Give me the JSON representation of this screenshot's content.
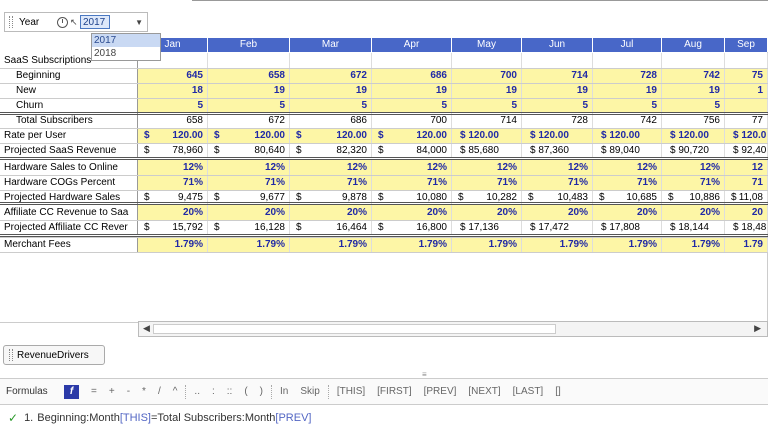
{
  "selector": {
    "label": "Year",
    "value": "2017",
    "options": [
      "2017",
      "2018"
    ]
  },
  "months": [
    "Jan",
    "Feb",
    "Mar",
    "Apr",
    "May",
    "Jun",
    "Jul",
    "Aug",
    "Sep"
  ],
  "rows": [
    {
      "label": "SaaS Subscriptions",
      "cells": [
        "",
        "",
        "",
        "",
        "",
        "",
        "",
        "",
        ""
      ]
    },
    {
      "label": "Beginning",
      "cells": [
        "645",
        "658",
        "672",
        "686",
        "700",
        "714",
        "728",
        "742",
        "75"
      ]
    },
    {
      "label": "New",
      "cells": [
        "18",
        "19",
        "19",
        "19",
        "19",
        "19",
        "19",
        "19",
        "1"
      ]
    },
    {
      "label": "Churn",
      "cells": [
        "5",
        "5",
        "5",
        "5",
        "5",
        "5",
        "5",
        "5",
        ""
      ]
    },
    {
      "label": "Total Subscribers",
      "cells": [
        "658",
        "672",
        "686",
        "700",
        "714",
        "728",
        "742",
        "756",
        "77"
      ]
    },
    {
      "label": "Rate per User",
      "cells": [
        "120.00",
        "120.00",
        "120.00",
        "120.00",
        "$ 120.00",
        "$ 120.00",
        "$ 120.00",
        "$ 120.00",
        "$ 120.0"
      ]
    },
    {
      "label": "Projected SaaS Revenue",
      "cells": [
        "78,960",
        "80,640",
        "82,320",
        "84,000",
        "$ 85,680",
        "$ 87,360",
        "$ 89,040",
        "$ 90,720",
        "$ 92,40"
      ]
    },
    {
      "label": "Hardware Sales to Online",
      "cells": [
        "12%",
        "12%",
        "12%",
        "12%",
        "12%",
        "12%",
        "12%",
        "12%",
        "12"
      ]
    },
    {
      "label": "Hardware COGs Percent",
      "cells": [
        "71%",
        "71%",
        "71%",
        "71%",
        "71%",
        "71%",
        "71%",
        "71%",
        "71"
      ]
    },
    {
      "label": "Projected Hardware Sales",
      "cells": [
        "9,475",
        "9,677",
        "9,878",
        "10,080",
        "10,282",
        "10,483",
        "10,685",
        "10,886",
        "11,08"
      ]
    },
    {
      "label": "Affiliate CC Revenue to Saa",
      "cells": [
        "20%",
        "20%",
        "20%",
        "20%",
        "20%",
        "20%",
        "20%",
        "20%",
        "20"
      ]
    },
    {
      "label": "Projected Affiliate CC Rever",
      "cells": [
        "15,792",
        "16,128",
        "16,464",
        "16,800",
        "$ 17,136",
        "$ 17,472",
        "$ 17,808",
        "$ 18,144",
        "$ 18,48"
      ]
    },
    {
      "label": "Merchant Fees",
      "cells": [
        "1.79%",
        "1.79%",
        "1.79%",
        "1.79%",
        "1.79%",
        "1.79%",
        "1.79%",
        "1.79%",
        "1.79"
      ]
    }
  ],
  "sheet_tab": "RevenueDrivers",
  "formula_bar": {
    "title": "Formulas",
    "fx": "f",
    "ops": [
      "=",
      "+",
      "-",
      "*",
      "/",
      "^"
    ],
    "ops2": [
      "..",
      ":",
      "::",
      "(",
      ")"
    ],
    "keywords": [
      "In",
      "Skip"
    ],
    "refs": [
      "[THIS]",
      "[FIRST]",
      "[PREV]",
      "[NEXT]",
      "[LAST]",
      "[]"
    ]
  },
  "formula": {
    "number": "1.",
    "part1": "Beginning:Month",
    "ref1": "[THIS]",
    "part2": "=Total Subscribers:Month",
    "ref2": "[PREV]"
  }
}
